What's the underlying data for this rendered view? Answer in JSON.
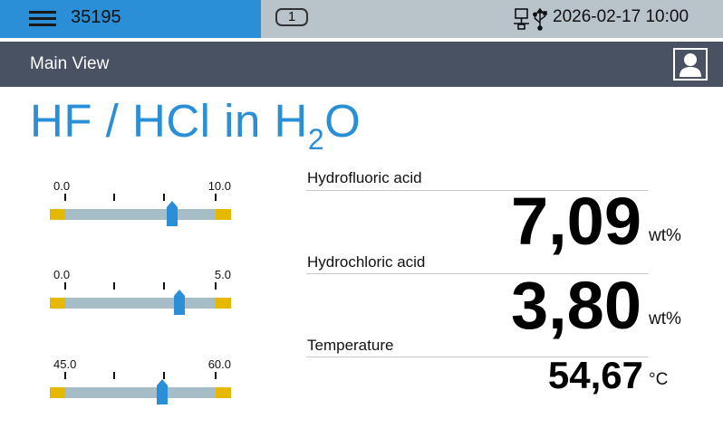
{
  "header": {
    "device_id": "35195",
    "badge": "1",
    "datetime": "2026-02-17 10:00",
    "icons": [
      "menu-icon",
      "network-icon",
      "usb-icon"
    ]
  },
  "nav": {
    "title": "Main View",
    "user_icon": "user-icon"
  },
  "title": {
    "main": "HF / HCl in H",
    "sub": "2",
    "tail": "O"
  },
  "colors": {
    "accent": "#2a8fd6",
    "topbar": "#b9c3ca",
    "navbar": "#485262",
    "limit": "#e6b800",
    "bar": "#a6bcc7"
  },
  "gauges": [
    {
      "min_label": "0.0",
      "max_label": "10.0",
      "value": 7.09,
      "min": 0,
      "max": 10
    },
    {
      "min_label": "0.0",
      "max_label": "5.0",
      "value": 3.8,
      "min": 0,
      "max": 5
    },
    {
      "min_label": "45.0",
      "max_label": "60.0",
      "value": 54.67,
      "min": 45,
      "max": 60
    }
  ],
  "measurements": [
    {
      "label": "Hydrofluoric acid",
      "value": "7,09",
      "unit": "wt%"
    },
    {
      "label": "Hydrochloric acid",
      "value": "3,80",
      "unit": "wt%"
    },
    {
      "label": "Temperature",
      "value": "54,67",
      "unit": "°C"
    }
  ]
}
